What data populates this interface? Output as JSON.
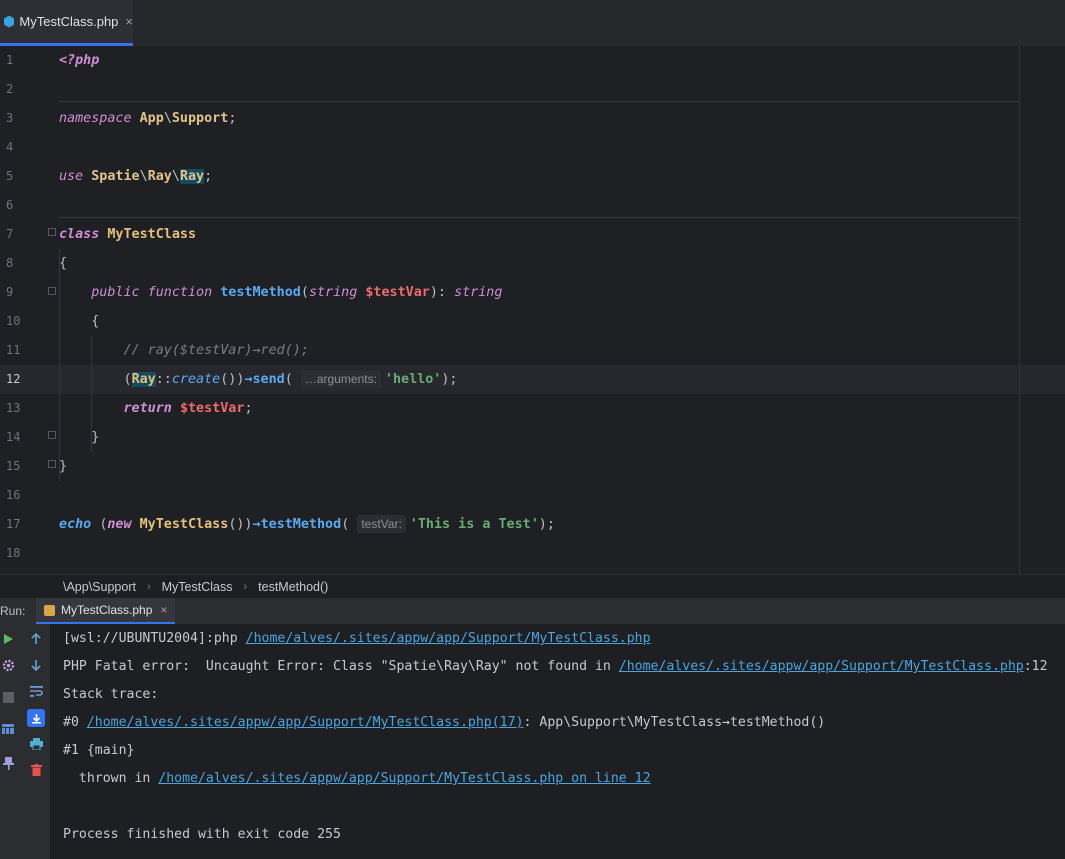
{
  "tab": {
    "label": "MyTestClass.php",
    "close": "×"
  },
  "line_numbers": [
    "1",
    "2",
    "3",
    "4",
    "5",
    "6",
    "7",
    "8",
    "9",
    "10",
    "11",
    "12",
    "13",
    "14",
    "15",
    "16",
    "17",
    "18"
  ],
  "code": {
    "l1": {
      "open_tag": "<?php"
    },
    "l3": {
      "kw": "namespace",
      "ns1": "App",
      "sep": "\\",
      "ns2": "Support",
      "end": ";"
    },
    "l5": {
      "kw": "use",
      "ns1": "Spatie",
      "sep1": "\\",
      "ns2": "Ray",
      "sep2": "\\",
      "ns3": "Ray",
      "end": ";"
    },
    "l7": {
      "kw": "class",
      "name": "MyTestClass"
    },
    "l8": {
      "brace": "{"
    },
    "l9": {
      "public": "public",
      "function": "function",
      "name": "testMethod",
      "open": "(",
      "type": "string",
      "var": "$testVar",
      "close": "): ",
      "ret": "string"
    },
    "l10": {
      "brace": "{"
    },
    "l11": {
      "comment": "// ray($testVar)→red();"
    },
    "l12": {
      "open": "(",
      "cls": "Ray",
      "dc": "::",
      "create": "create",
      "paren": "()",
      "close": ")",
      "arrow": "→",
      "send": "send",
      "open2": "(",
      "hint": "…arguments:",
      "str": "'hello'",
      "end": ");"
    },
    "l13": {
      "kw": "return",
      "var": "$testVar",
      "end": ";"
    },
    "l14": {
      "brace": "}"
    },
    "l15": {
      "brace": "}"
    },
    "l17": {
      "echo": "echo",
      "open": "(",
      "new": "new",
      "cls": "MyTestClass",
      "parens": "())",
      "arrow": "→",
      "method": "testMethod",
      "open2": "(",
      "hint": "testVar:",
      "str": "'This is a Test'",
      "end": ");"
    }
  },
  "breadcrumb": {
    "ns": "\\App\\Support",
    "cls": "MyTestClass",
    "method": "testMethod()",
    "arrow": "›"
  },
  "run": {
    "label": "Run:",
    "tab_label": "MyTestClass.php",
    "close": "×"
  },
  "console": {
    "line1_prefix": "[wsl://UBUNTU2004]:php ",
    "line1_link": "/home/alves/.sites/appw/app/Support/MyTestClass.php",
    "line2_prefix": "PHP Fatal error:  Uncaught Error: Class \"Spatie\\Ray\\Ray\" not found in ",
    "line2_link": "/home/alves/.sites/appw/app/Support/MyTestClass.php",
    "line2_suffix": ":12",
    "line3": "Stack trace:",
    "line4_prefix": "#0 ",
    "line4_link": "/home/alves/.sites/appw/app/Support/MyTestClass.php(17)",
    "line4_suffix": ": App\\Support\\MyTestClass→testMethod()",
    "line5": "#1 {main}",
    "line6_prefix": "  thrown in ",
    "line6_link": "/home/alves/.sites/appw/app/Support/MyTestClass.php on line 12",
    "line8": "Process finished with exit code 255"
  },
  "icons": [
    "php-file-icon",
    "run-icon",
    "settings-icon",
    "stop-icon",
    "layout-icon",
    "pin-icon",
    "up-arrow-icon",
    "down-arrow-icon",
    "soft-wrap-icon",
    "scroll-to-end-icon",
    "print-icon",
    "trash-icon"
  ],
  "colors": {
    "accent": "#3574f0",
    "keyword": "#cf8ed6",
    "class": "#e5c07b",
    "function": "#58aaef",
    "variable": "#ee6b6b",
    "string": "#6aab73",
    "link": "#4aa5e0"
  }
}
